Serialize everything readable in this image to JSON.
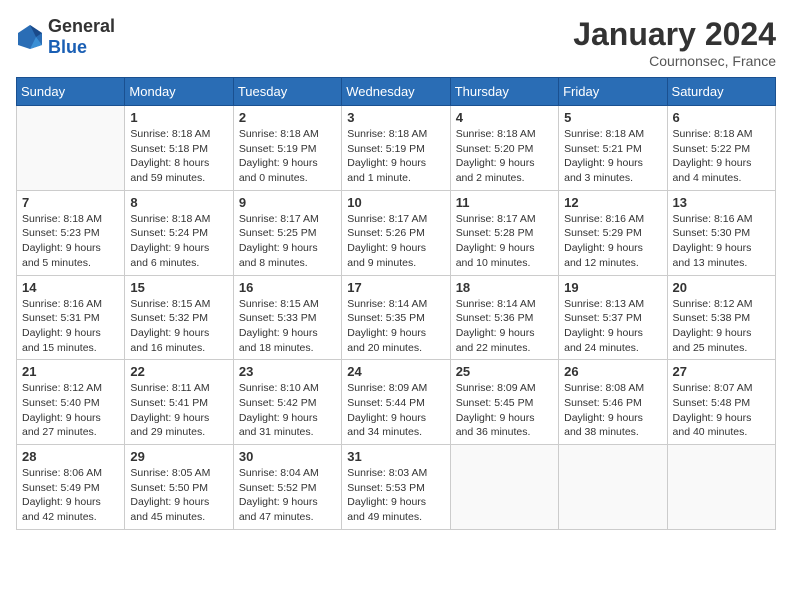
{
  "logo": {
    "general": "General",
    "blue": "Blue"
  },
  "header": {
    "month_year": "January 2024",
    "location": "Cournonsec, France"
  },
  "weekdays": [
    "Sunday",
    "Monday",
    "Tuesday",
    "Wednesday",
    "Thursday",
    "Friday",
    "Saturday"
  ],
  "weeks": [
    [
      {
        "day": "",
        "info": ""
      },
      {
        "day": "1",
        "info": "Sunrise: 8:18 AM\nSunset: 5:18 PM\nDaylight: 8 hours\nand 59 minutes."
      },
      {
        "day": "2",
        "info": "Sunrise: 8:18 AM\nSunset: 5:19 PM\nDaylight: 9 hours\nand 0 minutes."
      },
      {
        "day": "3",
        "info": "Sunrise: 8:18 AM\nSunset: 5:19 PM\nDaylight: 9 hours\nand 1 minute."
      },
      {
        "day": "4",
        "info": "Sunrise: 8:18 AM\nSunset: 5:20 PM\nDaylight: 9 hours\nand 2 minutes."
      },
      {
        "day": "5",
        "info": "Sunrise: 8:18 AM\nSunset: 5:21 PM\nDaylight: 9 hours\nand 3 minutes."
      },
      {
        "day": "6",
        "info": "Sunrise: 8:18 AM\nSunset: 5:22 PM\nDaylight: 9 hours\nand 4 minutes."
      }
    ],
    [
      {
        "day": "7",
        "info": "Sunrise: 8:18 AM\nSunset: 5:23 PM\nDaylight: 9 hours\nand 5 minutes."
      },
      {
        "day": "8",
        "info": "Sunrise: 8:18 AM\nSunset: 5:24 PM\nDaylight: 9 hours\nand 6 minutes."
      },
      {
        "day": "9",
        "info": "Sunrise: 8:17 AM\nSunset: 5:25 PM\nDaylight: 9 hours\nand 8 minutes."
      },
      {
        "day": "10",
        "info": "Sunrise: 8:17 AM\nSunset: 5:26 PM\nDaylight: 9 hours\nand 9 minutes."
      },
      {
        "day": "11",
        "info": "Sunrise: 8:17 AM\nSunset: 5:28 PM\nDaylight: 9 hours\nand 10 minutes."
      },
      {
        "day": "12",
        "info": "Sunrise: 8:16 AM\nSunset: 5:29 PM\nDaylight: 9 hours\nand 12 minutes."
      },
      {
        "day": "13",
        "info": "Sunrise: 8:16 AM\nSunset: 5:30 PM\nDaylight: 9 hours\nand 13 minutes."
      }
    ],
    [
      {
        "day": "14",
        "info": "Sunrise: 8:16 AM\nSunset: 5:31 PM\nDaylight: 9 hours\nand 15 minutes."
      },
      {
        "day": "15",
        "info": "Sunrise: 8:15 AM\nSunset: 5:32 PM\nDaylight: 9 hours\nand 16 minutes."
      },
      {
        "day": "16",
        "info": "Sunrise: 8:15 AM\nSunset: 5:33 PM\nDaylight: 9 hours\nand 18 minutes."
      },
      {
        "day": "17",
        "info": "Sunrise: 8:14 AM\nSunset: 5:35 PM\nDaylight: 9 hours\nand 20 minutes."
      },
      {
        "day": "18",
        "info": "Sunrise: 8:14 AM\nSunset: 5:36 PM\nDaylight: 9 hours\nand 22 minutes."
      },
      {
        "day": "19",
        "info": "Sunrise: 8:13 AM\nSunset: 5:37 PM\nDaylight: 9 hours\nand 24 minutes."
      },
      {
        "day": "20",
        "info": "Sunrise: 8:12 AM\nSunset: 5:38 PM\nDaylight: 9 hours\nand 25 minutes."
      }
    ],
    [
      {
        "day": "21",
        "info": "Sunrise: 8:12 AM\nSunset: 5:40 PM\nDaylight: 9 hours\nand 27 minutes."
      },
      {
        "day": "22",
        "info": "Sunrise: 8:11 AM\nSunset: 5:41 PM\nDaylight: 9 hours\nand 29 minutes."
      },
      {
        "day": "23",
        "info": "Sunrise: 8:10 AM\nSunset: 5:42 PM\nDaylight: 9 hours\nand 31 minutes."
      },
      {
        "day": "24",
        "info": "Sunrise: 8:09 AM\nSunset: 5:44 PM\nDaylight: 9 hours\nand 34 minutes."
      },
      {
        "day": "25",
        "info": "Sunrise: 8:09 AM\nSunset: 5:45 PM\nDaylight: 9 hours\nand 36 minutes."
      },
      {
        "day": "26",
        "info": "Sunrise: 8:08 AM\nSunset: 5:46 PM\nDaylight: 9 hours\nand 38 minutes."
      },
      {
        "day": "27",
        "info": "Sunrise: 8:07 AM\nSunset: 5:48 PM\nDaylight: 9 hours\nand 40 minutes."
      }
    ],
    [
      {
        "day": "28",
        "info": "Sunrise: 8:06 AM\nSunset: 5:49 PM\nDaylight: 9 hours\nand 42 minutes."
      },
      {
        "day": "29",
        "info": "Sunrise: 8:05 AM\nSunset: 5:50 PM\nDaylight: 9 hours\nand 45 minutes."
      },
      {
        "day": "30",
        "info": "Sunrise: 8:04 AM\nSunset: 5:52 PM\nDaylight: 9 hours\nand 47 minutes."
      },
      {
        "day": "31",
        "info": "Sunrise: 8:03 AM\nSunset: 5:53 PM\nDaylight: 9 hours\nand 49 minutes."
      },
      {
        "day": "",
        "info": ""
      },
      {
        "day": "",
        "info": ""
      },
      {
        "day": "",
        "info": ""
      }
    ]
  ]
}
